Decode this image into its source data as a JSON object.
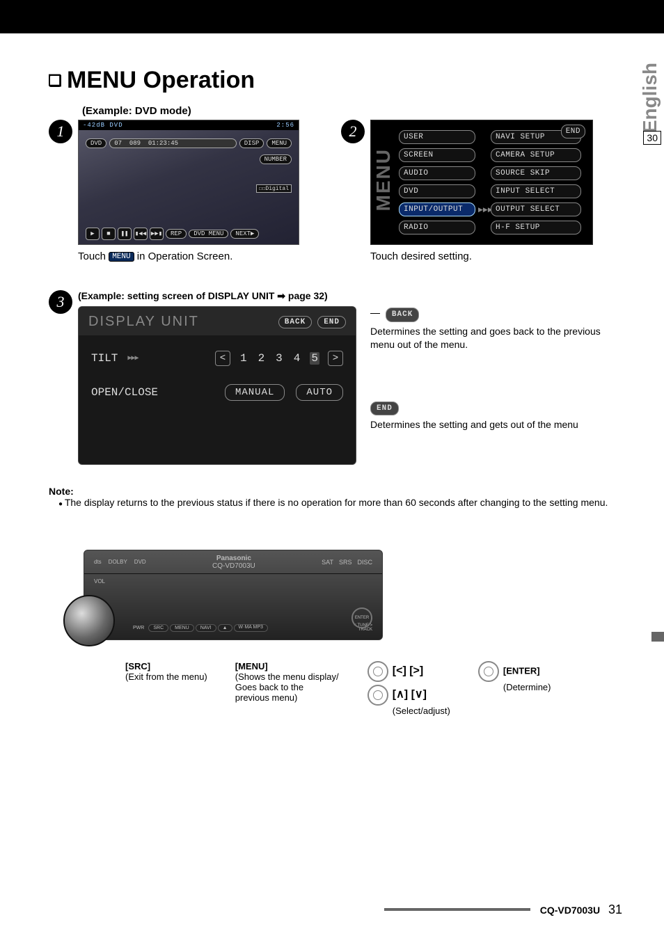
{
  "side": {
    "lang": "English",
    "sidepg": "30"
  },
  "title": "MENU Operation",
  "example1": "(Example: DVD mode)",
  "steps": {
    "n1": "1",
    "n2": "2",
    "n3": "3"
  },
  "dvd": {
    "top_left": "-42dB  DVD",
    "top_right": "2:56",
    "badge": "DVD",
    "track": "07",
    "chapter": "089",
    "time": "01:23:45",
    "disp": "DISP",
    "menu": "MENU",
    "number": "NUMBER",
    "digital": "Digital",
    "rep": "REP",
    "dvdmenu": "DVD\nMENU",
    "next": "NEXT"
  },
  "caption1a": "Touch ",
  "caption1b": " in Operation Screen.",
  "menu_badge": "MENU",
  "menu": {
    "side": "MENU",
    "left": [
      "USER",
      "SCREEN",
      "AUDIO",
      "DVD",
      "INPUT/OUTPUT",
      "RADIO"
    ],
    "right": [
      "NAVI SETUP",
      "CAMERA SETUP",
      "SOURCE SKIP",
      "INPUT SELECT",
      "OUTPUT SELECT",
      "H-F SETUP"
    ],
    "end": "END"
  },
  "caption2": "Touch desired setting.",
  "step3head": "(Example: setting screen of DISPLAY UNIT ➡ page 32)",
  "display_unit": {
    "title": "DISPLAY UNIT",
    "back": "BACK",
    "end": "END",
    "tilt": "TILT",
    "nums": [
      "1",
      "2",
      "3",
      "4",
      "5"
    ],
    "open": "OPEN/CLOSE",
    "manual": "MANUAL",
    "auto": "AUTO"
  },
  "explain": {
    "back_btn": "BACK",
    "back_text": "Determines the setting and goes back to the previous menu out of the menu.",
    "end_btn": "END",
    "end_text": "Determines the setting and gets out of the menu"
  },
  "note_head": "Note:",
  "note_item": "The display returns to the previous status if there is no operation for more than 60 seconds after changing to the setting menu.",
  "unit": {
    "brand": "Panasonic",
    "model": "CQ-VD7003U",
    "vol": "VOL",
    "pwr": "PWR",
    "keys": [
      "SRC",
      "MENU",
      "NAVI",
      "▲",
      "W·MA\nMP3"
    ],
    "tune": "TUNE",
    "track": "TRACK",
    "enter": "ENTER",
    "logos_left": [
      "dts",
      "DOLBY",
      "DVD"
    ],
    "logos_right": [
      "SAT",
      "SRS",
      "DISC"
    ]
  },
  "ctrl": {
    "src_h": "[SRC]",
    "src_t": "(Exit from the menu)",
    "menu_h": "[MENU]",
    "menu_t": "(Shows the menu display/ Goes back to the previous menu)",
    "lr": "[<] [>]",
    "ud": "[∧] [∨]",
    "sel": "(Select/adjust)",
    "enter_h": "[ENTER]",
    "enter_t": "(Determine)"
  },
  "footer": {
    "model": "CQ-VD7003U",
    "pg": "31"
  }
}
